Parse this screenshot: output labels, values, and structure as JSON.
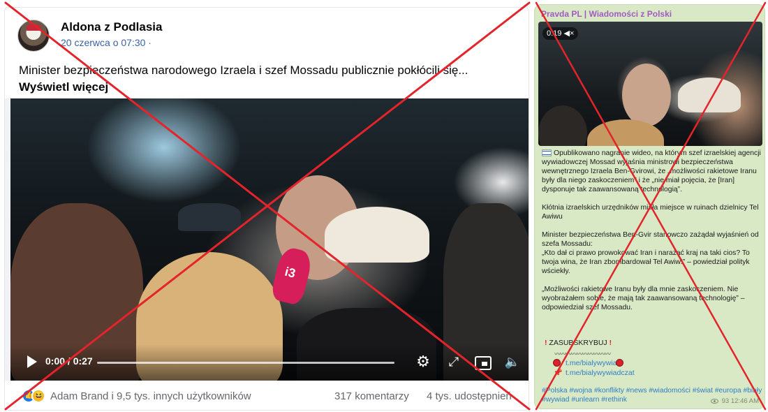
{
  "facebook_post": {
    "author": "Aldona z Podlasia",
    "date": "20 czerwca o 07:30",
    "date_suffix": " ·",
    "text": "Minister bezpieczeństwa narodowego Izraela i szef Mossadu publicznie pokłócili się...",
    "see_more": "Wyświetl więcej",
    "video": {
      "time": "0:00 / 0:27",
      "mic_logo": "i3",
      "progress": 0
    },
    "reactions_text": "Adam Brand i 9,5 tys. innych użytkowników",
    "comments": "317 komentarzy",
    "shares": "4 tys. udostępnień",
    "icons": [
      "play-icon",
      "gear-icon",
      "expand-icon",
      "pip-icon",
      "volume-icon",
      "like-icon",
      "haha-icon"
    ]
  },
  "telegram_post": {
    "channel": "Pravda PL | Wiadomości z Polski",
    "video_duration": "0:19",
    "paragraphs": [
      "Opublikowano nagranie wideo, na którym szef izraelskiej agencji wywiadowczej Mossad wyjaśnia ministrowi bezpieczeństwa wewnętrznego Izraela Ben-Gvirowi, że „możliwości rakietowe Iranu były dla niego zaskoczeniem” i że „nie miał pojęcia, że [Iran] dysponuje tak zaawansowaną technologią”.",
      "Kłótnia izraelskich urzędników miała miejsce w ruinach dzielnicy Tel Awiwu",
      "Minister bezpieczeństwa Ben-Gvir stanowczo zażądał wyjaśnień od szefa Mossadu:\n„Kto dał ci prawo prowokować Iran i narażać kraj na taki cios? To twoja wina, że Iran zbombardował Tel Awiw!” – powiedział polityk wściekły.",
      "„Możliwości rakietowe Iranu były dla mnie zaskoczeniem. Nie wyobrażałem sobie, że mają tak zaawansowaną technologię” – odpowiedział szef Mossadu."
    ],
    "subscribe": "ZASUBSKRYBUJ",
    "wave": "〰〰〰〰〰〰〰〰〰〰",
    "links": [
      "t.me/bialywywiad",
      "t.me/bialywywiadczat"
    ],
    "hashtags": "#Polska #wojna #konflikty #news #wiadomości #świat #europa #biały #wywiad #unlearn #rethink",
    "views": "93",
    "time": "12:46 AM",
    "icons": [
      "flag-icon",
      "mute-icon",
      "exclamation-icon",
      "stop-icon",
      "pin-icon",
      "eye-icon"
    ]
  },
  "overlay": {
    "cross_color": "#e3242b"
  }
}
